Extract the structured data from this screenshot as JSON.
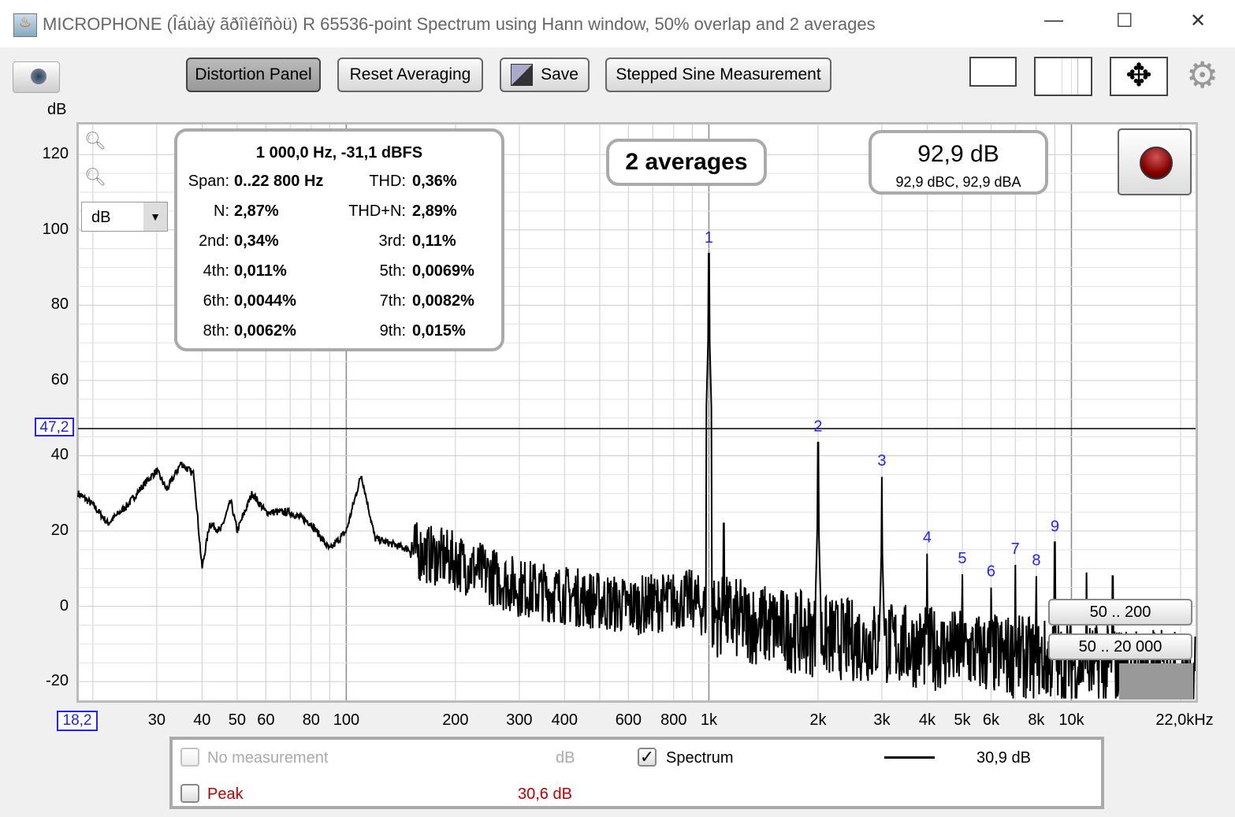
{
  "window": {
    "title": "MICROPHONE (Îáùàÿ ãðîìêîñòü) R 65536-point Spectrum using Hann window, 50% overlap and 2 averages",
    "minimize": "—",
    "maximize": "☐",
    "close": "✕"
  },
  "toolbar": {
    "distortion_panel": "Distortion Panel",
    "reset_averaging": "Reset Averaging",
    "save": "Save",
    "stepped_sine": "Stepped Sine Measurement"
  },
  "plot": {
    "y_unit": "dB",
    "unit_select": "dB",
    "cursor_y": "47,2",
    "cursor_x": "18,2",
    "averages": "2 averages",
    "level": "92,9 dB",
    "level_sub": "92,9 dBC, 92,9 dBA",
    "range1": "50 .. 200",
    "range2": "50 .. 20 000"
  },
  "distortion": {
    "header": "1 000,0 Hz, -31,1 dBFS",
    "rows": [
      [
        "Span:",
        "0..22 800 Hz",
        "THD:",
        "0,36%"
      ],
      [
        "N:",
        "2,87%",
        "THD+N:",
        "2,89%"
      ],
      [
        "2nd:",
        "0,34%",
        "3rd:",
        "0,11%"
      ],
      [
        "4th:",
        "0,011%",
        "5th:",
        "0,0069%"
      ],
      [
        "6th:",
        "0,0044%",
        "7th:",
        "0,0082%"
      ],
      [
        "8th:",
        "0,0062%",
        "9th:",
        "0,015%"
      ]
    ]
  },
  "legend": {
    "no_measurement": "No measurement",
    "no_measurement_unit": "dB",
    "spectrum": "Spectrum",
    "spectrum_value": "30,9 dB",
    "peak": "Peak",
    "peak_value": "30,6 dB",
    "spectrum_checked": true,
    "peak_color": "#c00000"
  },
  "chart_data": {
    "type": "line",
    "xscale": "log",
    "xlim": [
      18.2,
      22000
    ],
    "ylim": [
      -25,
      128
    ],
    "grid": true,
    "y_ticks": [
      "120",
      "100",
      "80",
      "60",
      "40",
      "20",
      "0",
      "-20"
    ],
    "y_tick_values": [
      120,
      100,
      80,
      60,
      40,
      20,
      0,
      -20
    ],
    "x_ticks": [
      "30",
      "40",
      "50",
      "60",
      "80",
      "100",
      "200",
      "300",
      "400",
      "600",
      "800",
      "1k",
      "2k",
      "3k",
      "4k",
      "5k",
      "6k",
      "8k",
      "10k",
      "22,0kHz"
    ],
    "x_tick_values": [
      30,
      40,
      50,
      60,
      80,
      100,
      200,
      300,
      400,
      600,
      800,
      1000,
      2000,
      3000,
      4000,
      5000,
      6000,
      8000,
      10000,
      22000
    ],
    "cursor_level_db": 47.2,
    "noise_floor": {
      "x": [
        18.2,
        20,
        22,
        25,
        28,
        30,
        32,
        35,
        38,
        40,
        42,
        45,
        48,
        50,
        55,
        60,
        70,
        80,
        90,
        100,
        110,
        120,
        150,
        200,
        300,
        400,
        600,
        900,
        1000,
        2000,
        5000,
        10000,
        22000
      ],
      "y": [
        30,
        27,
        22,
        27,
        33,
        36,
        31,
        38,
        35,
        10,
        22,
        20,
        28,
        20,
        30,
        25,
        25,
        22,
        15,
        20,
        35,
        18,
        15,
        12,
        5,
        3,
        0,
        2,
        -2,
        -8,
        -12,
        -15,
        -18
      ]
    },
    "harmonics": [
      {
        "label": "1",
        "f": 1000,
        "db": 93.7
      },
      {
        "label": "2",
        "f": 2000,
        "db": 43.5
      },
      {
        "label": "3",
        "f": 3000,
        "db": 34.4
      },
      {
        "label": "4",
        "f": 4000,
        "db": 14
      },
      {
        "label": "5",
        "f": 5000,
        "db": 8.5
      },
      {
        "label": "6",
        "f": 6000,
        "db": 5
      },
      {
        "label": "7",
        "f": 7000,
        "db": 11
      },
      {
        "label": "8",
        "f": 8000,
        "db": 8
      },
      {
        "label": "9",
        "f": 9000,
        "db": 17
      }
    ],
    "other_peaks": [
      {
        "f": 1100,
        "db": 22
      },
      {
        "f": 11000,
        "db": 9
      },
      {
        "f": 13000,
        "db": 8
      }
    ]
  }
}
